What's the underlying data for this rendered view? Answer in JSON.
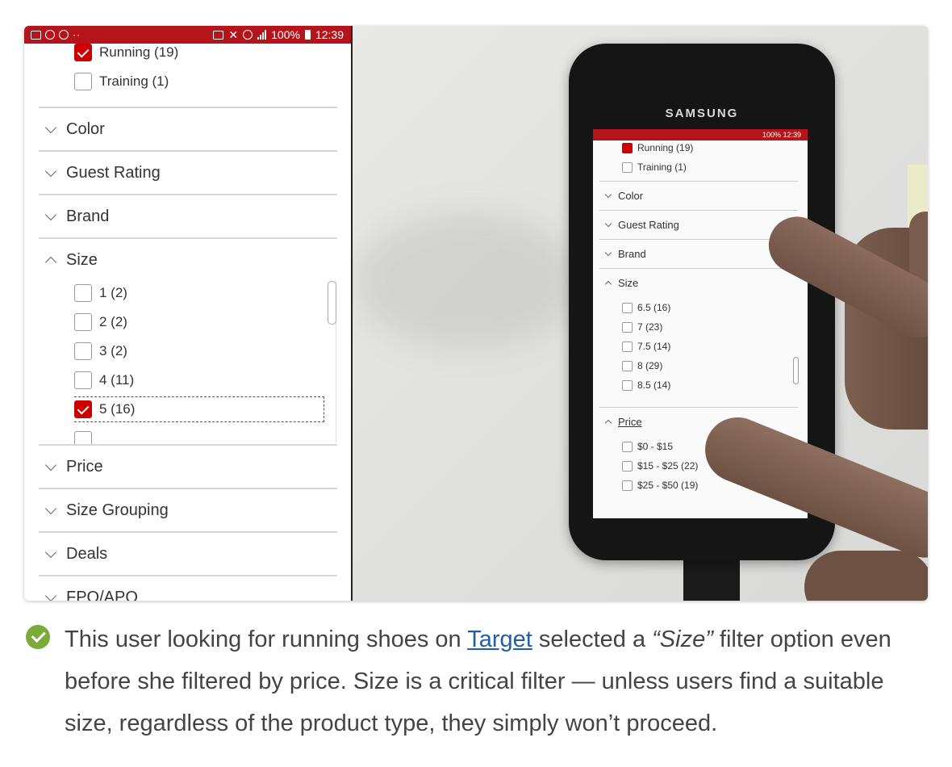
{
  "status_bar": {
    "battery": "100%",
    "time": "12:39"
  },
  "screenshot": {
    "top_options": [
      {
        "label": "Running (19)",
        "checked": true
      },
      {
        "label": "Training (1)",
        "checked": false
      }
    ],
    "sections_before": [
      "Color",
      "Guest Rating",
      "Brand"
    ],
    "size_section": {
      "label": "Size",
      "expanded": true,
      "options": [
        {
          "label": "1 (2)",
          "checked": false
        },
        {
          "label": "2 (2)",
          "checked": false
        },
        {
          "label": "3 (2)",
          "checked": false
        },
        {
          "label": "4 (11)",
          "checked": false
        },
        {
          "label": "5 (16)",
          "checked": true,
          "focused": true
        }
      ]
    },
    "sections_after": [
      "Price",
      "Size Grouping",
      "Deals",
      "FPO/APO"
    ]
  },
  "photo": {
    "brand": "SAMSUNG",
    "status": "100% 12:39",
    "top_options": [
      {
        "label": "Running (19)",
        "checked": true
      },
      {
        "label": "Training (1)",
        "checked": false
      }
    ],
    "sections": [
      "Color",
      "Guest Rating",
      "Brand"
    ],
    "size_label": "Size",
    "size_options": [
      "6.5 (16)",
      "7 (23)",
      "7.5 (14)",
      "8 (29)",
      "8.5 (14)"
    ],
    "price_label": "Price",
    "price_options": [
      "$0 - $15",
      "$15 - $25 (22)",
      "$25 - $50 (19)"
    ]
  },
  "caption": {
    "part1": "This user looking for running shoes on ",
    "link": "Target",
    "part2": " selected a ",
    "quoted": "“Size”",
    "part3": " filter option even before she filtered by price. Size is a critical filter — unless users find a suitable size, regardless of the product type, they simply won’t proceed."
  },
  "colors": {
    "accent_red": "#cc0000",
    "status_red": "#b5151a",
    "check_green": "#7aaa3a",
    "link_blue": "#1f5fa8"
  }
}
